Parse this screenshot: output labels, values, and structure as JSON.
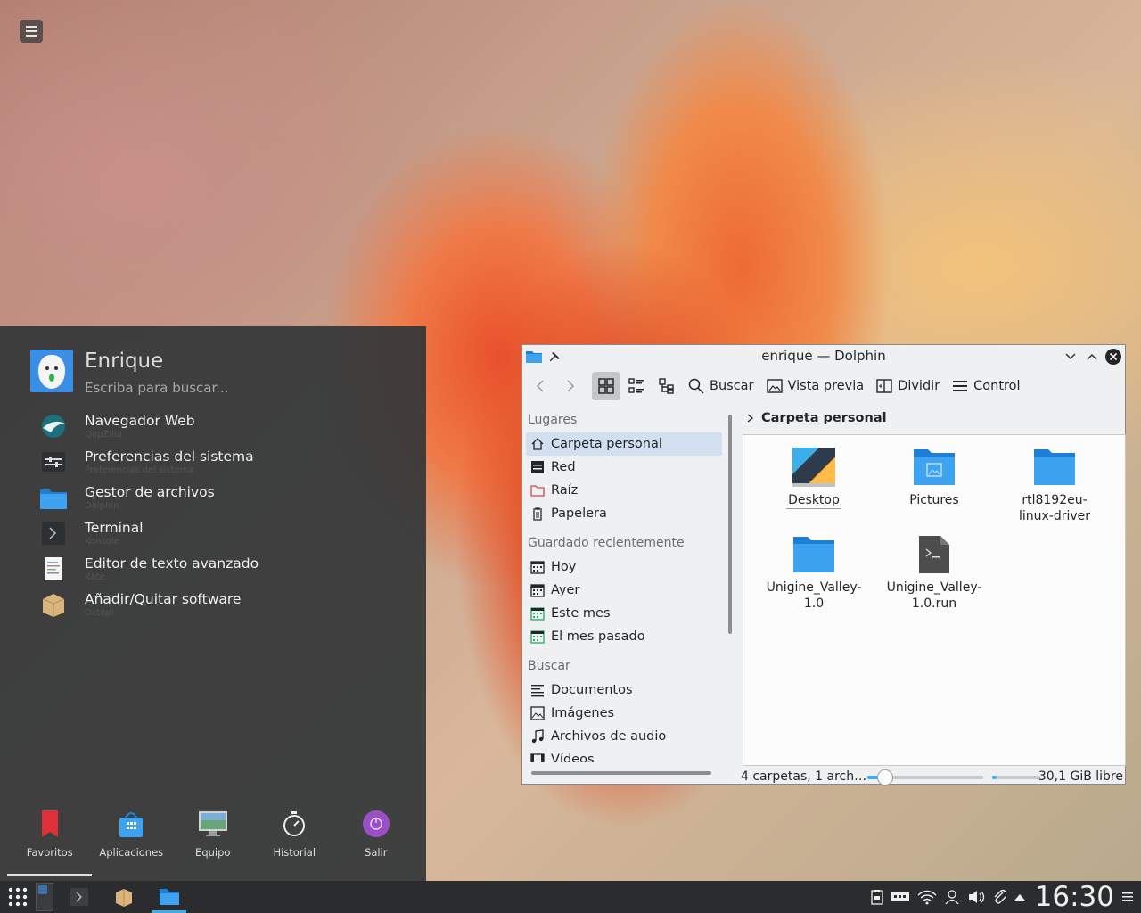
{
  "launcher": {
    "user": "Enrique",
    "search_placeholder": "Escriba para buscar...",
    "apps": [
      {
        "title": "Navegador Web",
        "sub": "QupZilla",
        "icon": "qupzilla-icon"
      },
      {
        "title": "Preferencias del sistema",
        "sub": "Preferencias del sistema",
        "icon": "system-settings-icon"
      },
      {
        "title": "Gestor de archivos",
        "sub": "Dolphin",
        "icon": "folder-icon"
      },
      {
        "title": "Terminal",
        "sub": "Konsole",
        "icon": "terminal-icon"
      },
      {
        "title": "Editor de texto avanzado",
        "sub": "Kate",
        "icon": "text-editor-icon"
      },
      {
        "title": "Añadir/Quitar software",
        "sub": "Octopi",
        "icon": "package-icon"
      }
    ],
    "tabs": [
      "Favoritos",
      "Aplicaciones",
      "Equipo",
      "Historial",
      "Salir"
    ]
  },
  "dolphin": {
    "title": "enrique — Dolphin",
    "toolbar": {
      "search": "Buscar",
      "preview": "Vista previa",
      "split": "Dividir",
      "control": "Control"
    },
    "places": {
      "header": "Lugares",
      "items": [
        "Carpeta personal",
        "Red",
        "Raíz",
        "Papelera"
      ],
      "recent_header": "Guardado recientemente",
      "recent": [
        "Hoy",
        "Ayer",
        "Este mes",
        "El mes pasado"
      ],
      "search_header": "Buscar",
      "search": [
        "Documentos",
        "Imágenes",
        "Archivos de audio",
        "Vídeos"
      ]
    },
    "breadcrumb": "Carpeta personal",
    "files": [
      {
        "name": "Desktop"
      },
      {
        "name": "Pictures"
      },
      {
        "name": "rtl8192eu-linux-driver"
      },
      {
        "name": "Unigine_Valley-1.0"
      },
      {
        "name": "Unigine_Valley-1.0.run"
      }
    ],
    "status": {
      "summary": "4 carpetas, 1 arch…",
      "free": "30,1 GiB libre",
      "zoom_level": 0.15,
      "disk_used_fraction": 0.1
    }
  },
  "taskbar": {
    "clock": "16:30"
  },
  "colors": {
    "accent": "#3daee9",
    "panel": "#2a2c2e",
    "launcher_bg": "#343739",
    "selection": "#d2dff1"
  }
}
